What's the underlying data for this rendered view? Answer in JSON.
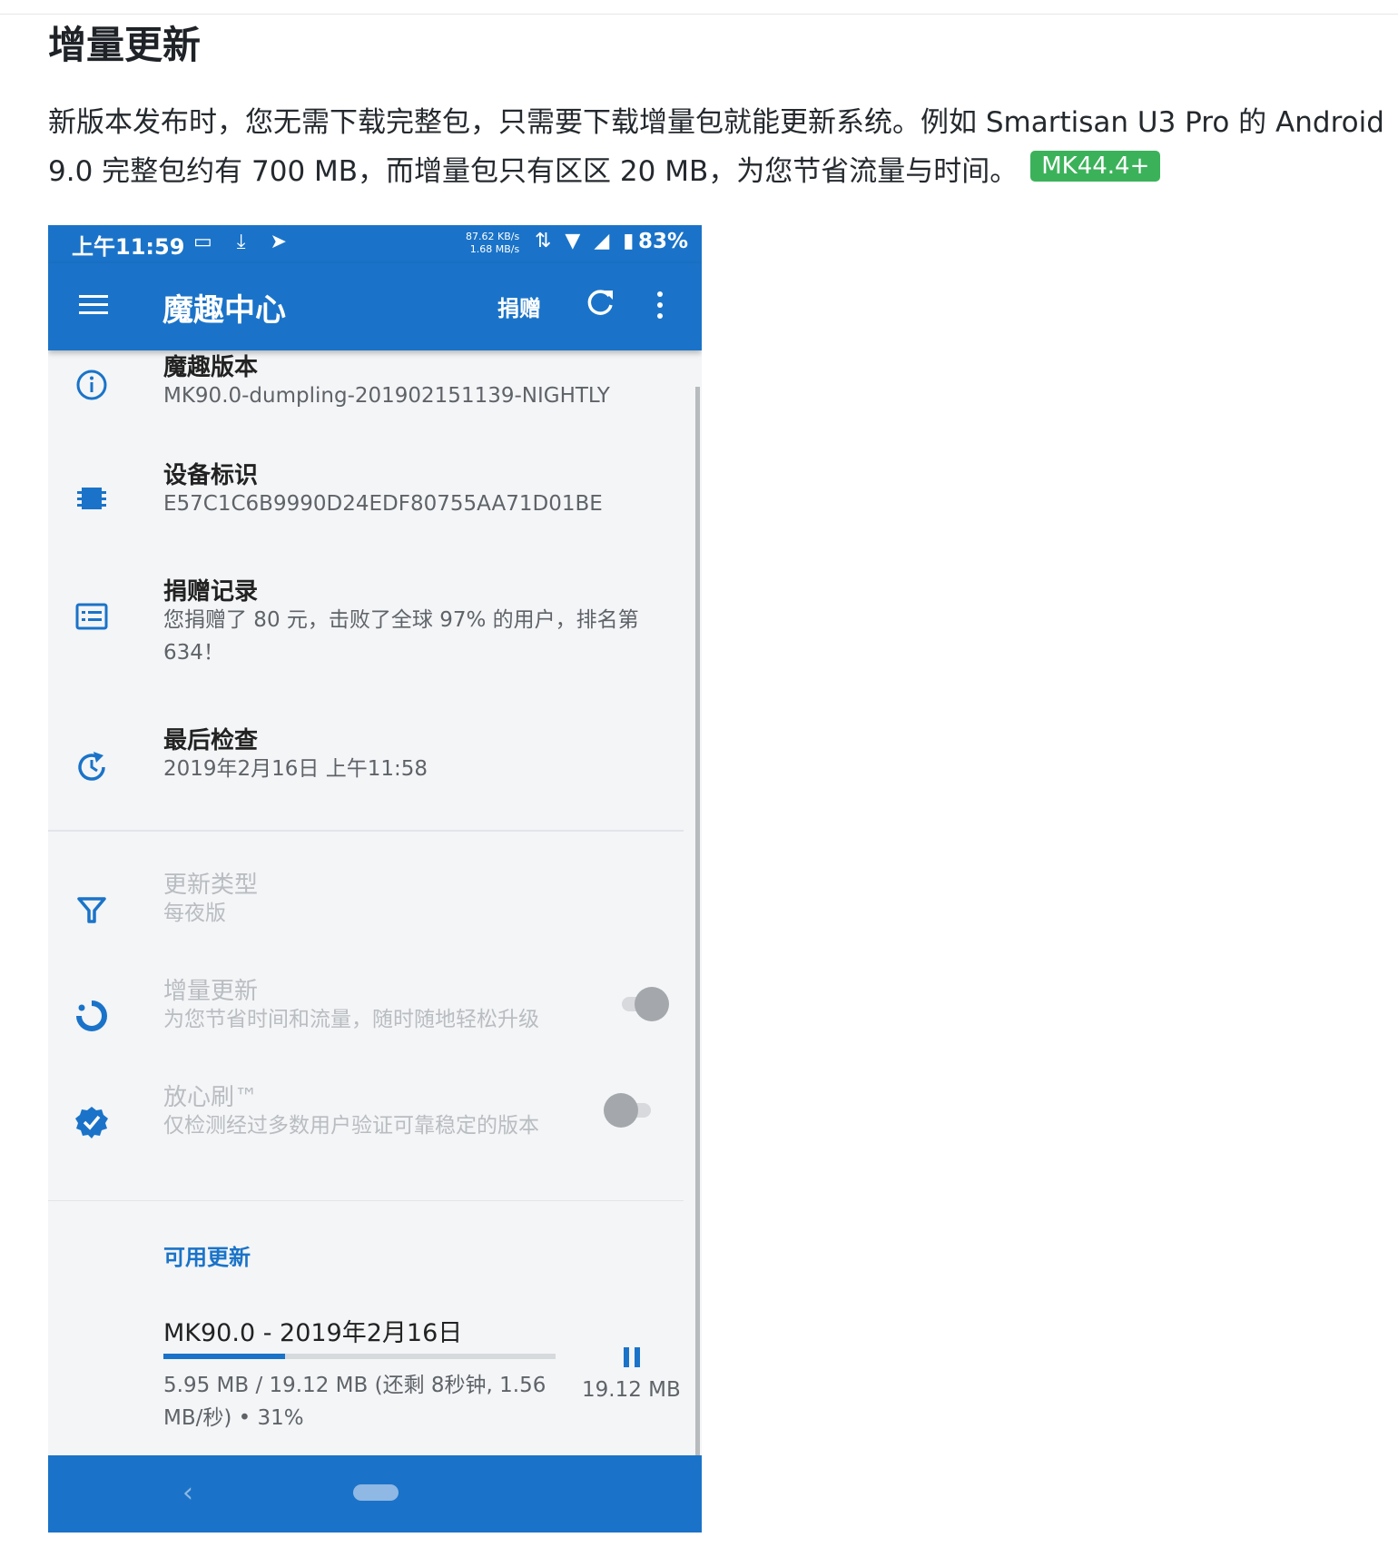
{
  "doc": {
    "title": "增量更新",
    "paragraph": "新版本发布时，您无需下载完整包，只需要下载增量包就能更新系统。例如 Smartisan U3 Pro 的 Android 9.0 完整包约有 700 MB，而增量包只有区区 20 MB，为您节省流量与时间。",
    "badge": "MK44.4+",
    "badge_color": "#3bb25a"
  },
  "phone": {
    "status": {
      "time": "上午11:59",
      "left_icons": "▭ ⤓ ➤",
      "speed_up": "87.62 KB/s",
      "speed_down": "1.68 MB/s",
      "right_icons": "⇅ ▼ ◢ ▮",
      "battery": "83%"
    },
    "appbar": {
      "title": "魔趣中心",
      "donate": "捐赠"
    },
    "accent": "#1a73c8",
    "items": [
      {
        "title": "魔趣版本",
        "subtitle": "MK90.0-dumpling-20190215113​9-NIGHTLY",
        "icon": "info-icon"
      },
      {
        "title": "设备标识",
        "subtitle": "E57C1C6B9990D24EDF80755AA71D01BE",
        "icon": "chip-icon"
      },
      {
        "title": "捐赠记录",
        "subtitle": "您捐赠了 80 元，击败了全球 97% 的用户，排名第 634！",
        "icon": "receipt-icon"
      },
      {
        "title": "最后检查",
        "subtitle": "2019年2月16日 上午11:58",
        "icon": "clock-refresh-icon"
      }
    ],
    "settings": [
      {
        "title": "更新类型",
        "subtitle": "每夜版",
        "icon": "filter-icon"
      },
      {
        "title": "增量更新",
        "subtitle": "为您节省时间和流量，随时随地轻松升级",
        "icon": "delta-update-icon",
        "toggle_on": true
      },
      {
        "title": "放心刷™",
        "subtitle": "仅检测经过多数用户验证可靠稳定的版本",
        "icon": "verified-icon",
        "toggle_on": false
      }
    ],
    "updates": {
      "section_label": "可用更新",
      "title": "MK90.0 - 2019年2月16日",
      "status": "5.95 MB / 19.12 MB (还剩 8秒钟, 1.56 MB/秒) • 31%",
      "size": "19.12 MB",
      "progress": 0.31
    },
    "nav": {
      "back": "‹"
    }
  }
}
